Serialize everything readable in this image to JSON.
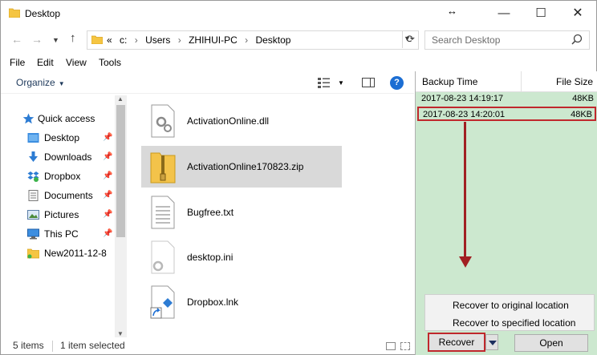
{
  "window": {
    "title": "Desktop",
    "resize_glyph": "↔",
    "minimize": "—",
    "maximize": "☐",
    "close": "✕"
  },
  "address": {
    "back": "←",
    "forward": "→",
    "up": "↑",
    "crumbs": [
      "«",
      "c:",
      "Users",
      "ZHIHUI-PC",
      "Desktop"
    ],
    "separator": "›",
    "search_placeholder": "Search Desktop"
  },
  "menu": [
    "File",
    "Edit",
    "View",
    "Tools"
  ],
  "toolbar": {
    "organize": "Organize"
  },
  "navpane": {
    "items": [
      {
        "label": "Quick access",
        "icon": "star-icon",
        "pinned": false
      },
      {
        "label": "Desktop",
        "icon": "desktop-icon",
        "pinned": true
      },
      {
        "label": "Downloads",
        "icon": "download-icon",
        "pinned": true
      },
      {
        "label": "Dropbox",
        "icon": "dropbox-icon",
        "pinned": true
      },
      {
        "label": "Documents",
        "icon": "documents-icon",
        "pinned": true
      },
      {
        "label": "Pictures",
        "icon": "pictures-icon",
        "pinned": true
      },
      {
        "label": "This PC",
        "icon": "computer-icon",
        "pinned": true
      },
      {
        "label": "New2011-12-8",
        "icon": "folder-icon",
        "pinned": false
      }
    ]
  },
  "files": [
    {
      "name": "ActivationOnline.dll",
      "icon": "dll-icon",
      "selected": false
    },
    {
      "name": "ActivationOnline170823.zip",
      "icon": "zip-folder-icon",
      "selected": true
    },
    {
      "name": "Bugfree.txt",
      "icon": "text-file-icon",
      "selected": false
    },
    {
      "name": "desktop.ini",
      "icon": "settings-file-icon",
      "selected": false
    },
    {
      "name": "Dropbox.lnk",
      "icon": "shortcut-icon",
      "selected": false
    }
  ],
  "status": {
    "count": "5 items",
    "selection": "1 item selected"
  },
  "backup": {
    "headers": {
      "time": "Backup Time",
      "size": "File Size"
    },
    "rows": [
      {
        "time": "2017-08-23 14:19:17",
        "size": "48KB",
        "selected": false
      },
      {
        "time": "2017-08-23 14:20:01",
        "size": "48KB",
        "selected": true
      }
    ],
    "context_menu": [
      "Recover to original location",
      "Recover to specified location"
    ],
    "recover_label": "Recover",
    "open_label": "Open"
  },
  "colors": {
    "panel_bg": "#cce8cf",
    "highlight": "#c0282d",
    "arrow": "#a11f22",
    "selection": "#d9d9d9"
  }
}
